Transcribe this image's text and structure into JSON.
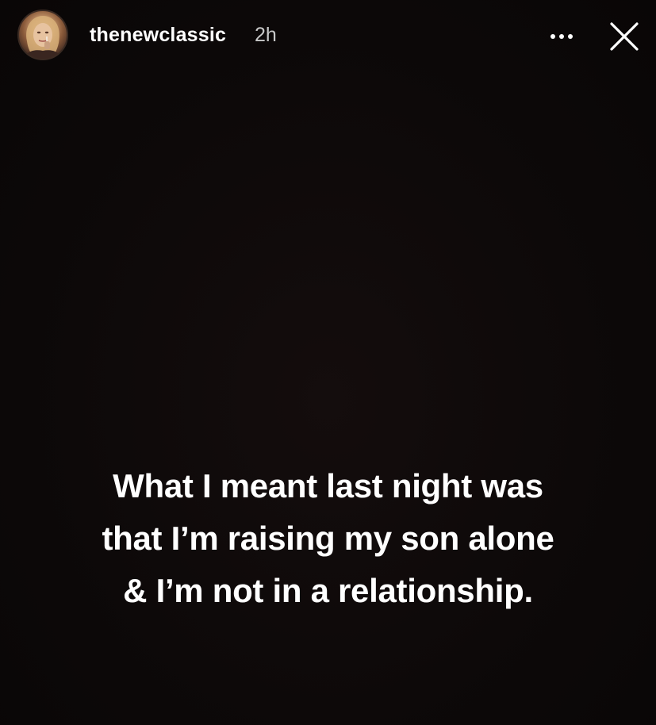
{
  "story": {
    "username": "thenewclassic",
    "timestamp": "2h",
    "caption_lines": [
      "What I meant last night was",
      "that I’m raising my son alone",
      "& I’m not in a relationship."
    ]
  },
  "icons": {
    "avatar": "profile-photo",
    "more": "more-options-icon",
    "close": "close-icon"
  },
  "colors": {
    "background": "#0c0808",
    "text": "#ffffff",
    "timestamp": "#c8c8c8"
  }
}
